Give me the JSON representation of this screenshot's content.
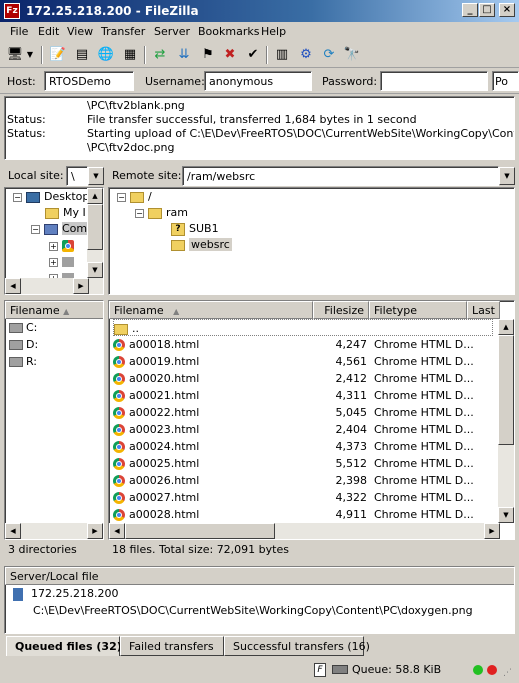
{
  "window": {
    "title": "172.25.218.200 - FileZilla",
    "app_icon": "Fz"
  },
  "menu": [
    "File",
    "Edit",
    "View",
    "Transfer",
    "Server",
    "Bookmarks",
    "Help"
  ],
  "toolbar": {
    "icons": [
      "site-manager-icon",
      "dropdown-icon",
      "toggle-log-icon",
      "toggle-tree-local-icon",
      "toggle-tree-remote-icon",
      "toggle-queue-icon",
      "refresh-icon",
      "process-queue-icon",
      "cancel-icon",
      "disconnect-icon",
      "reconnect-icon",
      "filter-icon",
      "compare-icon",
      "sync-browse-icon",
      "search-icon"
    ]
  },
  "quickconnect": {
    "host_label": "Host:",
    "host_value": "RTOSDemo",
    "user_label": "Username:",
    "user_value": "anonymous",
    "pass_label": "Password:",
    "pass_value": "",
    "port_value": "Po"
  },
  "log": [
    {
      "k": "",
      "v": "\\PC\\ftv2blank.png"
    },
    {
      "k": "Status:",
      "v": "File transfer successful, transferred 1,684 bytes in 1 second"
    },
    {
      "k": "Status:",
      "v": "Starting upload of C:\\E\\Dev\\FreeRTOS\\DOC\\CurrentWebSite\\WorkingCopy\\Content"
    },
    {
      "k": "",
      "v": "\\PC\\ftv2doc.png"
    }
  ],
  "local": {
    "site_label": "Local site:",
    "site_value": "\\",
    "tree": [
      "Desktop",
      "My I",
      "Com"
    ],
    "columns": {
      "filename": "Filename"
    },
    "files": [
      "C:",
      "D:",
      "R:"
    ],
    "status": "3 directories"
  },
  "remote": {
    "site_label": "Remote site:",
    "site_value": "/ram/websrc",
    "tree": [
      "/",
      "ram",
      "SUB1",
      "websrc"
    ],
    "columns": {
      "filename": "Filename",
      "filesize": "Filesize",
      "filetype": "Filetype",
      "last": "Last"
    },
    "parent": "..",
    "files": [
      {
        "name": "a00018.html",
        "size": "4,247",
        "type": "Chrome HTML D..."
      },
      {
        "name": "a00019.html",
        "size": "4,561",
        "type": "Chrome HTML D..."
      },
      {
        "name": "a00020.html",
        "size": "2,412",
        "type": "Chrome HTML D..."
      },
      {
        "name": "a00021.html",
        "size": "4,311",
        "type": "Chrome HTML D..."
      },
      {
        "name": "a00022.html",
        "size": "5,045",
        "type": "Chrome HTML D..."
      },
      {
        "name": "a00023.html",
        "size": "2,404",
        "type": "Chrome HTML D..."
      },
      {
        "name": "a00024.html",
        "size": "4,373",
        "type": "Chrome HTML D..."
      },
      {
        "name": "a00025.html",
        "size": "5,512",
        "type": "Chrome HTML D..."
      },
      {
        "name": "a00026.html",
        "size": "2,398",
        "type": "Chrome HTML D..."
      },
      {
        "name": "a00027.html",
        "size": "4,322",
        "type": "Chrome HTML D..."
      },
      {
        "name": "a00028.html",
        "size": "4,911",
        "type": "Chrome HTML D..."
      }
    ],
    "status": "18 files. Total size: 72,091 bytes"
  },
  "queue": {
    "header": "Server/Local file",
    "server": "172.25.218.200",
    "file": "C:\\E\\Dev\\FreeRTOS\\DOC\\CurrentWebSite\\WorkingCopy\\Content\\PC\\doxygen.png"
  },
  "tabs": {
    "queued": "Queued files (32)",
    "failed": "Failed transfers",
    "successful": "Successful transfers (16)"
  },
  "statusbar": {
    "queue": "Queue: 58.8 KiB"
  },
  "colors": {
    "title_gradient_start": "#0a246a",
    "led_green": "#22c022",
    "led_red": "#e02020"
  }
}
